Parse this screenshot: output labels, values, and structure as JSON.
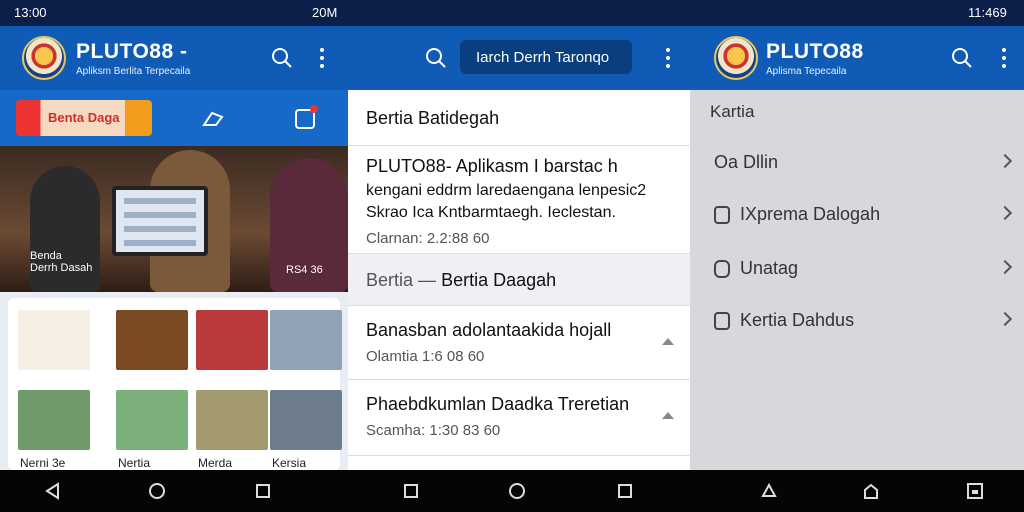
{
  "status": {
    "left_time": "13:00",
    "mid_text": "20M",
    "right_time": "11:469"
  },
  "left_app": {
    "brand": "PLUTO88 -",
    "tagline": "Apliksm Berlita Terpecaila",
    "banner_text": "Benta Daga",
    "hero_caption_left": "Benda\nDerrh Dasah",
    "hero_caption_right": "RS4 36",
    "thumbs": [
      "Nerni 3e",
      "Nertia",
      "Merda",
      "Kersia"
    ]
  },
  "mid_app": {
    "search_value": "Iarch Derrh Taronqo",
    "section1": "Bertia Batidegah",
    "article1": {
      "title": "PLUTO88- Aplikasm I barstac h",
      "body1": "kengani eddrm laredaengana lenpesic2",
      "body2": "Skrao Ica Kntbarmtaegh. Ieclestan.",
      "meta": "Clarnan: 2.2:88 60"
    },
    "section2_a": "Bertia",
    "section2_sep": "—",
    "section2_b": "Bertia Daagah",
    "article2": {
      "title": "Banasban adolantaakida hojall",
      "meta": "Olamtia 1:6 08 60"
    },
    "article3": {
      "title": "Phaebdkumlan Daadka Treretian",
      "meta": "Scamha: 1:30 83 60"
    }
  },
  "right_app": {
    "brand": "PLUTO88",
    "tagline": "Aplisma Tepecaila",
    "menu_title": "Kartia",
    "menu": [
      "Oa Dllin",
      "IXprema Dalogah",
      "Unatag",
      "Kertia Dahdus"
    ]
  },
  "colors": {
    "appbar": "#0f5bb5",
    "status": "#0b1f49"
  }
}
